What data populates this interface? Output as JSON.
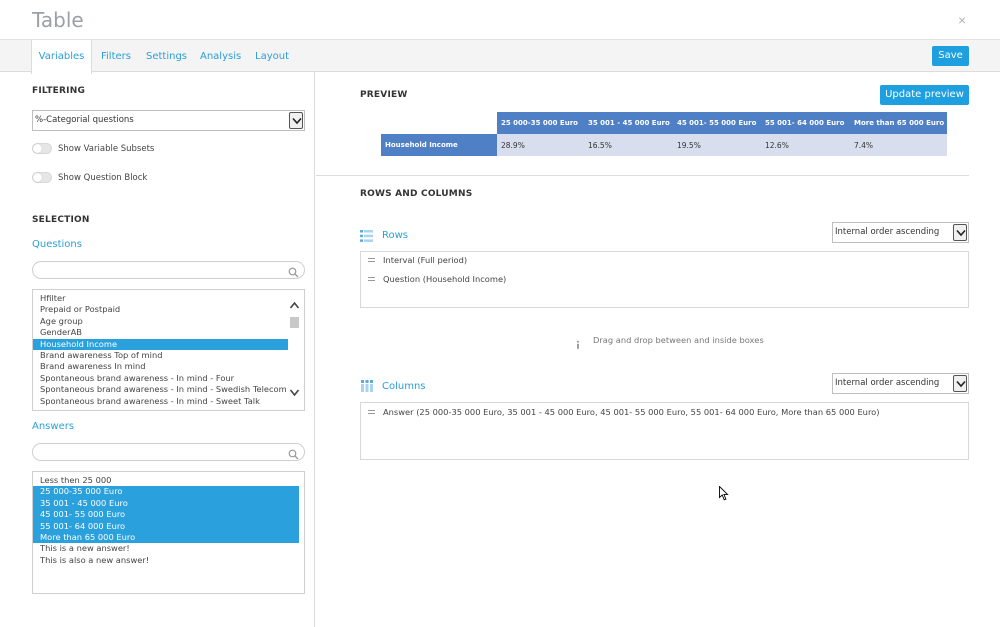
{
  "window": {
    "title": "Table",
    "close": "×"
  },
  "tabs": [
    {
      "label": "Variables"
    },
    {
      "label": "Filters"
    },
    {
      "label": "Settings"
    },
    {
      "label": "Analysis"
    },
    {
      "label": "Layout"
    }
  ],
  "save_label": "Save",
  "left": {
    "filtering_heading": "FILTERING",
    "filter_select_value": "%-Categorial questions",
    "toggle_subsets": "Show Variable Subsets",
    "toggle_block": "Show Question Block",
    "selection_heading": "SELECTION",
    "questions_heading": "Questions",
    "questions": [
      "Hfilter",
      "Prepaid or Postpaid",
      "Age group",
      "GenderAB",
      "Household Income",
      "Brand awareness Top of mind",
      "Brand awareness In mind",
      "Spontaneous brand awareness - In mind - Four",
      "Spontaneous brand awareness - In mind - Swedish Telecom",
      "Spontaneous brand awareness - In mind - Sweet Talk"
    ],
    "selected_question": "Household Income",
    "answers_heading": "Answers",
    "answers": [
      "Less then 25 000",
      "25 000-35 000 Euro",
      "35 001 - 45 000 Euro",
      "45 001- 55 000 Euro",
      "55 001- 64 000 Euro",
      "More than 65 000 Euro",
      "This is a new answer!",
      "This is also a new answer!"
    ],
    "selected_answers": [
      "25 000-35 000 Euro",
      "35 001 - 45 000 Euro",
      "45 001- 55 000 Euro",
      "55 001- 64 000 Euro",
      "More than 65 000 Euro"
    ]
  },
  "right": {
    "preview_heading": "PREVIEW",
    "update_label": "Update preview",
    "preview_table": {
      "columns": [
        "25 000-35 000 Euro",
        "35 001 - 45 000 Euro",
        "45 001- 55 000 Euro",
        "55 001- 64 000 Euro",
        "More than 65 000 Euro"
      ],
      "row_label": "Household Income",
      "values": [
        "28.9%",
        "16.5%",
        "19.5%",
        "12.6%",
        "7.4%"
      ]
    },
    "rows_columns_heading": "ROWS AND COLUMNS",
    "rows_heading": "Rows",
    "rows_sort": "Internal order ascending",
    "rows_items": [
      "Interval (Full period)",
      "Question (Household Income)"
    ],
    "drag_hint": "Drag and drop between and inside boxes",
    "columns_heading": "Columns",
    "columns_sort": "Internal order ascending",
    "columns_items": [
      "Answer (25 000-35 000 Euro, 35 001 - 45 000 Euro, 45 001- 55 000 Euro, 55 001- 64 000 Euro, More than 65 000 Euro)"
    ]
  },
  "colors": {
    "accent": "#1e9fe0",
    "selection": "#2aa0dc",
    "table_header": "#4f7fc4",
    "table_cell": "#d8deee"
  }
}
